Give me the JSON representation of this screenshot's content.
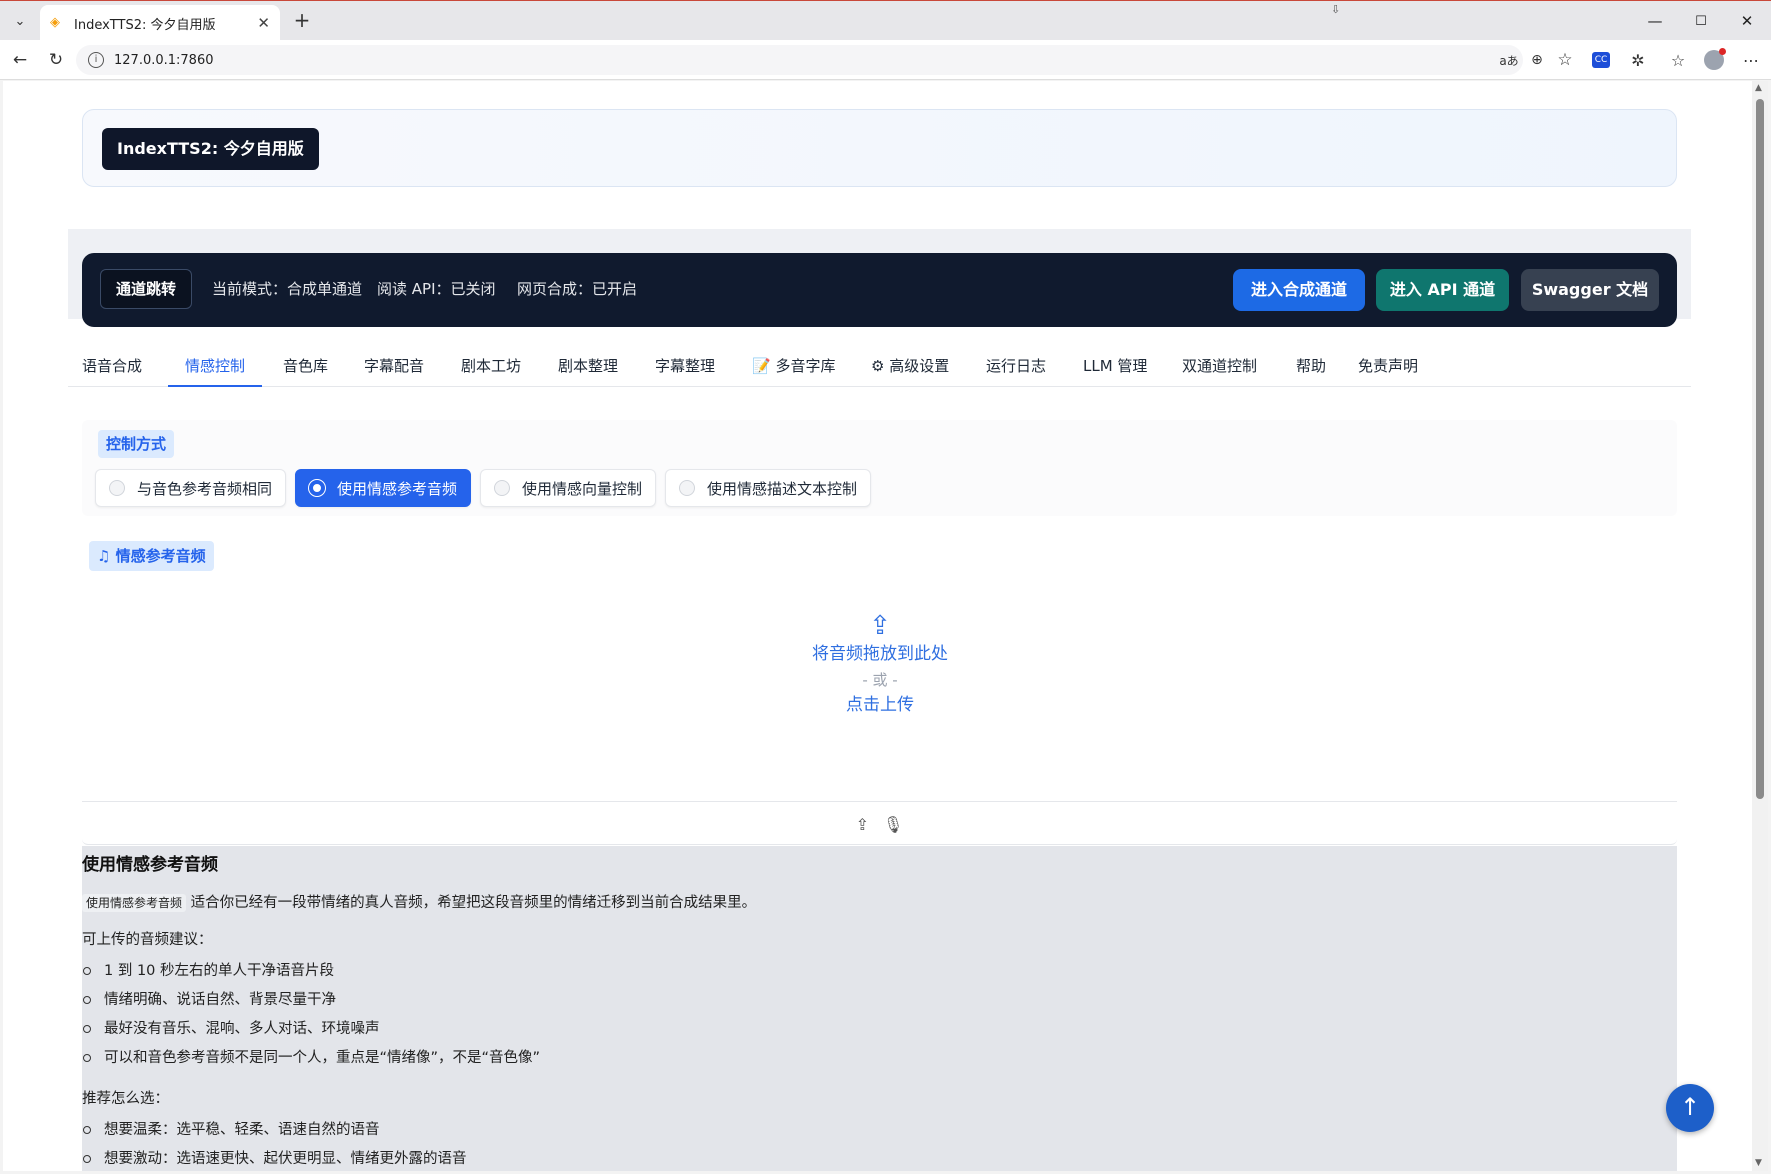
{
  "browser": {
    "tab_title": "IndexTTS2: 今夕自用版",
    "url": "127.0.0.1:7860",
    "controls": {
      "minimize": "—",
      "maximize": "☐",
      "close": "✕"
    }
  },
  "hero": {
    "title": "IndexTTS2: 今夕自用版"
  },
  "channel_bar": {
    "label": "通道跳转",
    "status_mode": "当前模式：合成单通道",
    "status_api": "阅读 API：已关闭",
    "status_web": "网页合成：已开启",
    "btn_synth": "进入合成通道",
    "btn_api": "进入 API 通道",
    "btn_swagger": "Swagger 文档",
    "colors": {
      "synth": "#1d6ae5",
      "api": "#0f766e",
      "swagger": "#374151"
    }
  },
  "tabs": [
    {
      "label": "语音合成"
    },
    {
      "label": "情感控制",
      "active": true
    },
    {
      "label": "音色库"
    },
    {
      "label": "字幕配音"
    },
    {
      "label": "剧本工坊"
    },
    {
      "label": "剧本整理"
    },
    {
      "label": "字幕整理"
    },
    {
      "label": "📝 多音字库"
    },
    {
      "label": "⚙ 高级设置"
    },
    {
      "label": "运行日志"
    },
    {
      "label": "LLM 管理"
    },
    {
      "label": "双通道控制"
    },
    {
      "label": "帮助"
    },
    {
      "label": "免责声明"
    }
  ],
  "control_mode": {
    "title": "控制方式",
    "options": [
      "与音色参考音频相同",
      "使用情感参考音频",
      "使用情感向量控制",
      "使用情感描述文本控制"
    ],
    "selected": "使用情感参考音频"
  },
  "emotion_audio": {
    "title": "情感参考音频",
    "drop_text": "将音频拖放到此处",
    "or_text": "- 或 -",
    "click_text": "点击上传"
  },
  "doc": {
    "heading": "使用情感参考音频",
    "intro_code": "使用情感参考音频",
    "intro_rest": "适合你已经有一段带情绪的真人音频，希望把这段音频里的情绪迁移到当前合成结果里。",
    "upload_title": "可上传的音频建议：",
    "upload_items": [
      "1 到 10 秒左右的单人干净语音片段",
      "情绪明确、说话自然、背景尽量干净",
      "最好没有音乐、混响、多人对话、环境噪声",
      "可以和音色参考音频不是同一个人，重点是“情绪像”，不是“音色像”"
    ],
    "choose_title": "推荐怎么选：",
    "choose_items": [
      "想要温柔：选平稳、轻柔、语速自然的语音",
      "想要激动：选语速更快、起伏更明显、情绪更外露的语音"
    ]
  }
}
